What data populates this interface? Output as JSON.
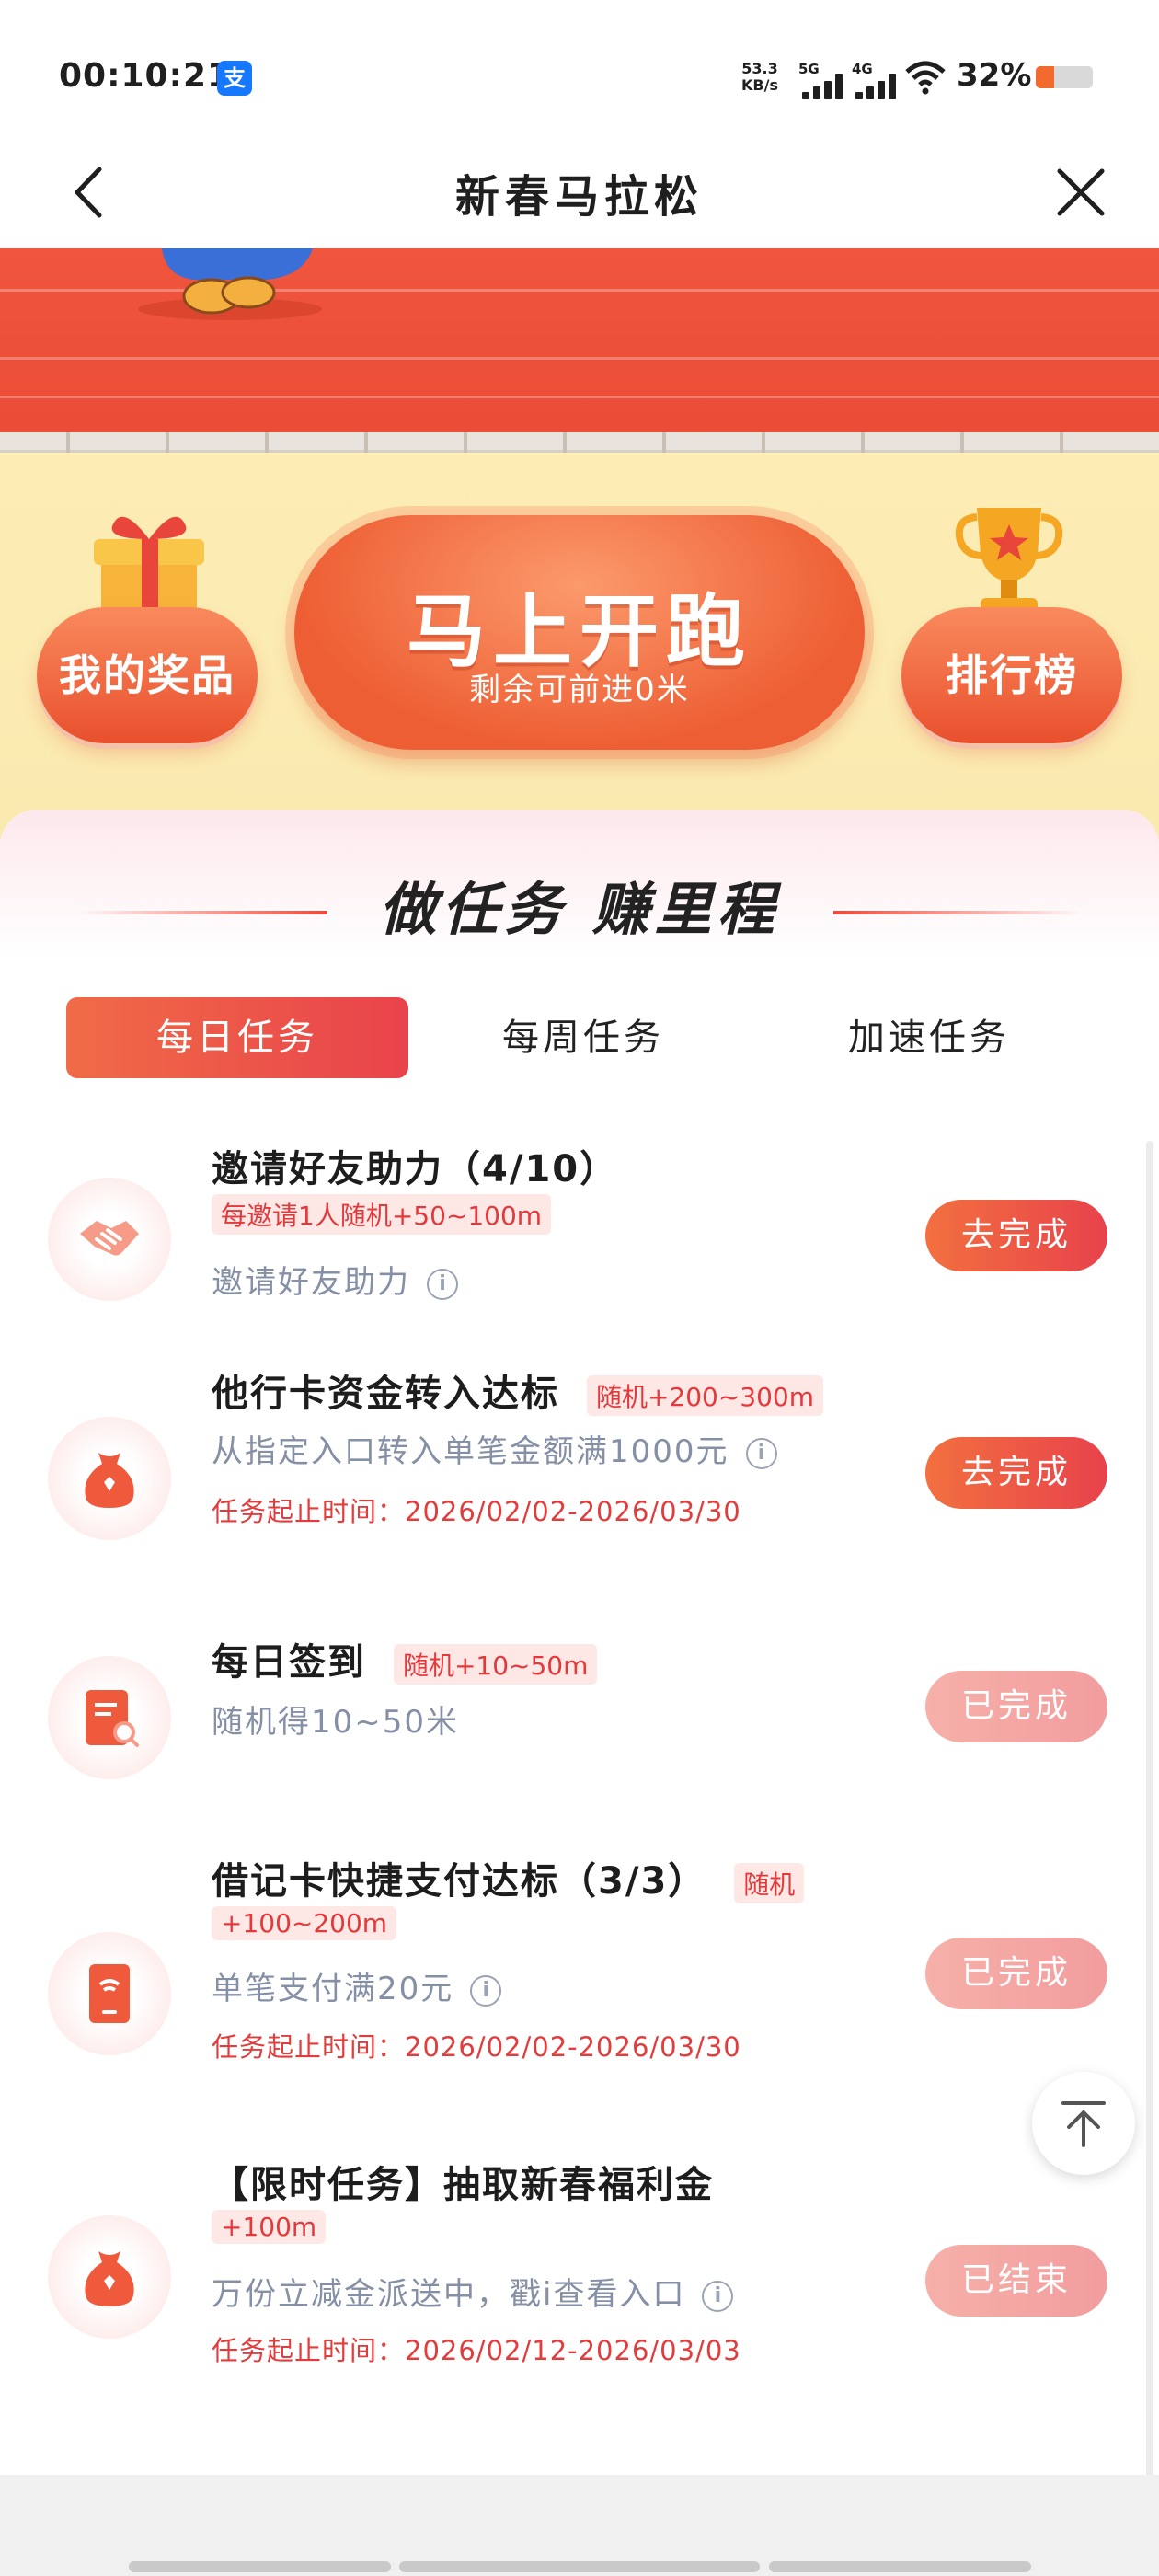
{
  "status_bar": {
    "time": "00:10:21",
    "app_badge": "支",
    "net_speed_value": "53.3",
    "net_speed_unit": "KB/s",
    "signal_1": "5G",
    "signal_2": "4G",
    "battery": "32%",
    "battery_level": 0.32
  },
  "header": {
    "title": "新春马拉松",
    "back_icon": "chevron-left-icon",
    "close_icon": "close-icon"
  },
  "hero": {
    "my_prizes_label": "我的奖品",
    "run_button_title": "马上开跑",
    "run_button_sub": "剩余可前进0米",
    "leaderboard_label": "排行榜"
  },
  "tasks_panel": {
    "title": "做任务 赚里程",
    "tabs": [
      {
        "label": "每日任务",
        "active": true
      },
      {
        "label": "每周任务",
        "active": false
      },
      {
        "label": "加速任务",
        "active": false
      }
    ],
    "items": [
      {
        "icon": "handshake-icon",
        "title": "邀请好友助力（4/10）",
        "reward": "每邀请1人随机+50~100m",
        "desc": "邀请好友助力",
        "time": "",
        "button": "去完成",
        "status": "todo"
      },
      {
        "icon": "money-bag-icon",
        "title": "他行卡资金转入达标",
        "reward": "随机+200~300m",
        "desc": "从指定入口转入单笔金额满1000元",
        "time": "任务起止时间：2026/02/02-2026/03/30",
        "button": "去完成",
        "status": "todo"
      },
      {
        "icon": "checkin-card-icon",
        "title": "每日签到",
        "reward": "随机+10~50m",
        "desc": "随机得10~50米",
        "time": "",
        "button": "已完成",
        "status": "done"
      },
      {
        "icon": "card-payment-icon",
        "title": "借记卡快捷支付达标（3/3）",
        "reward_part1": "随机",
        "reward_part2": "+100~200m",
        "desc": "单笔支付满20元",
        "time": "任务起止时间：2026/02/02-2026/03/30",
        "button": "已完成",
        "status": "done"
      },
      {
        "icon": "money-bag-icon",
        "title": "【限时任务】抽取新春福利金",
        "reward": "+100m",
        "desc": "万份立减金派送中，戳i查看入口",
        "time": "任务起止时间：2026/02/12-2026/03/03",
        "button": "已结束",
        "status": "ended"
      }
    ],
    "info_symbol": "i"
  },
  "scroll_top_icon": "arrow-up-to-top-icon",
  "colors": {
    "primary": "#e9473f",
    "done_button": "#f3a3a2",
    "track": "#ee513a",
    "hero_bg": "#fbeab2",
    "muted_text": "#8590a6",
    "time_text": "#e23c3c"
  }
}
